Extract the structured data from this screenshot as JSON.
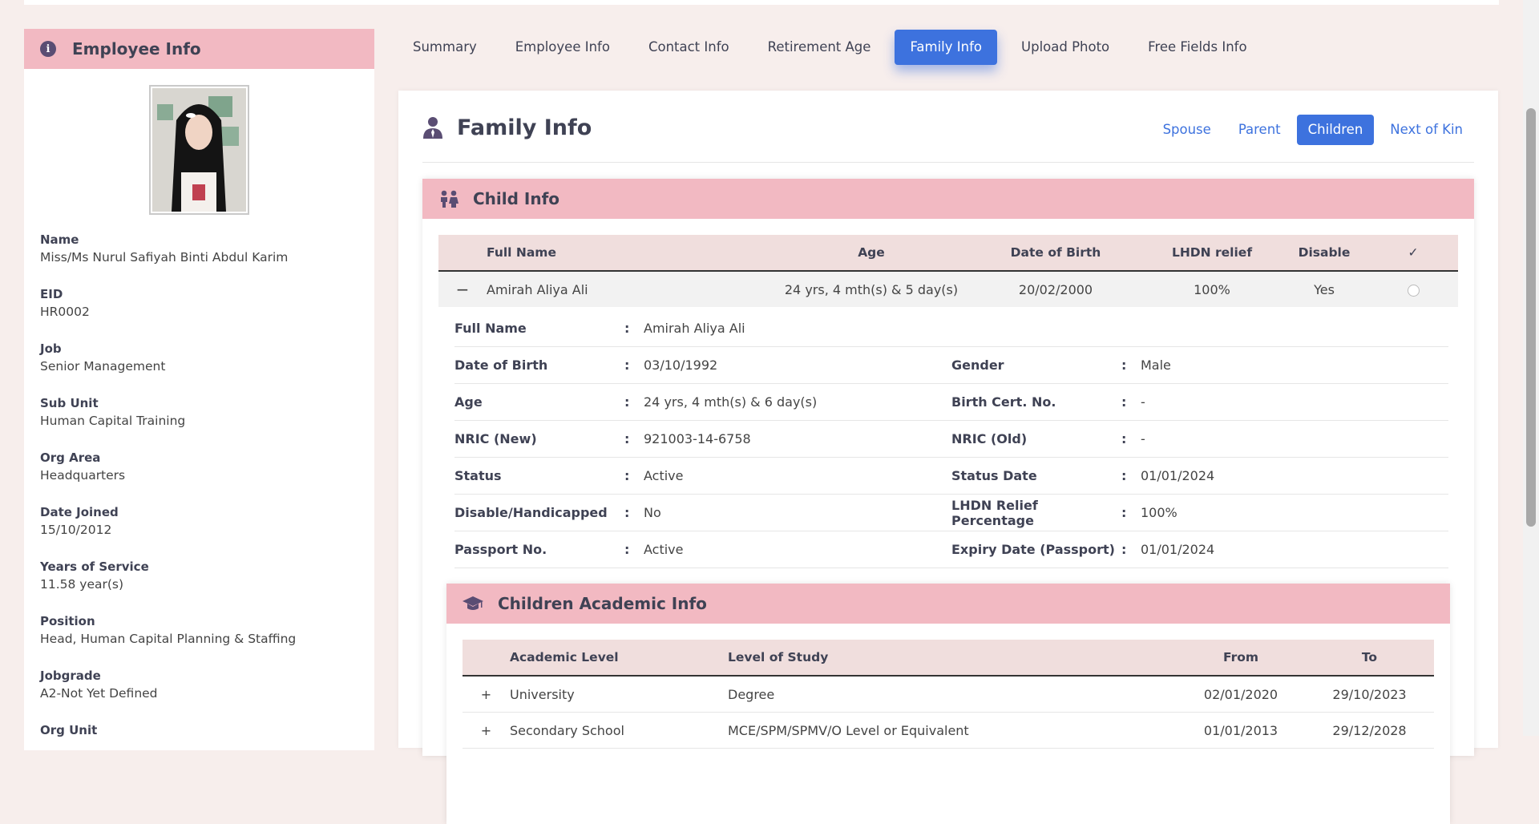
{
  "left": {
    "title": "Employee Info",
    "fields": [
      {
        "label": "Name",
        "value": "Miss/Ms Nurul Safiyah Binti Abdul Karim"
      },
      {
        "label": "EID",
        "value": "HR0002"
      },
      {
        "label": "Job",
        "value": "Senior Management"
      },
      {
        "label": "Sub Unit",
        "value": "Human Capital Training"
      },
      {
        "label": "Org Area",
        "value": "Headquarters"
      },
      {
        "label": "Date Joined",
        "value": "15/10/2012"
      },
      {
        "label": "Years of Service",
        "value": "11.58 year(s)"
      },
      {
        "label": "Position",
        "value": "Head, Human Capital Planning & Staffing"
      },
      {
        "label": "Jobgrade",
        "value": "A2-Not Yet Defined"
      },
      {
        "label": "Org Unit",
        "value": ""
      }
    ]
  },
  "tabs": [
    "Summary",
    "Employee Info",
    "Contact Info",
    "Retirement Age",
    "Family Info",
    "Upload Photo",
    "Free Fields Info"
  ],
  "active_tab": "Family Info",
  "main": {
    "title": "Family Info",
    "subtabs": [
      "Spouse",
      "Parent",
      "Children",
      "Next of Kin"
    ],
    "active_subtab": "Children"
  },
  "child": {
    "title": "Child Info",
    "headers": {
      "full_name": "Full Name",
      "age": "Age",
      "dob": "Date of Birth",
      "lhdn": "LHDN relief",
      "disable": "Disable",
      "check": "✓"
    },
    "row": {
      "toggle": "−",
      "full_name": "Amirah Aliya Ali",
      "age": "24 yrs, 4 mth(s) & 5 day(s)",
      "dob": "20/02/2000",
      "lhdn": "100%",
      "disable": "Yes"
    },
    "details": [
      {
        "l1": "Full Name",
        "v1": "Amirah Aliya Ali",
        "l2": "",
        "v2": ""
      },
      {
        "l1": "Date of Birth",
        "v1": "03/10/1992",
        "l2": "Gender",
        "v2": "Male"
      },
      {
        "l1": "Age",
        "v1": "24 yrs, 4 mth(s) & 6 day(s)",
        "l2": "Birth Cert. No.",
        "v2": "-"
      },
      {
        "l1": "NRIC (New)",
        "v1": "921003-14-6758",
        "l2": "NRIC (Old)",
        "v2": "-"
      },
      {
        "l1": "Status",
        "v1": "Active",
        "l2": "Status Date",
        "v2": "01/01/2024"
      },
      {
        "l1": "Disable/Handicapped",
        "v1": "No",
        "l2": "LHDN Relief Percentage",
        "v2": "100%"
      },
      {
        "l1": "Passport No.",
        "v1": "Active",
        "l2": "Expiry Date (Passport)",
        "v2": "01/01/2024"
      }
    ],
    "colon": ":"
  },
  "academic": {
    "title": "Children Academic Info",
    "headers": {
      "level": "Academic Level",
      "study": "Level of Study",
      "from": "From",
      "to": "To"
    },
    "rows": [
      {
        "toggle": "+",
        "level": "University",
        "study": "Degree",
        "from": "02/01/2020",
        "to": "29/10/2023"
      },
      {
        "toggle": "+",
        "level": "Secondary School",
        "study": "MCE/SPM/SPMV/O Level or Equivalent",
        "from": "01/01/2013",
        "to": "29/12/2028"
      }
    ]
  },
  "colors": {
    "accent": "#3d72de",
    "header_pink": "#f2b9c2",
    "table_head": "#f0dedd",
    "background": "#f7eeec"
  }
}
